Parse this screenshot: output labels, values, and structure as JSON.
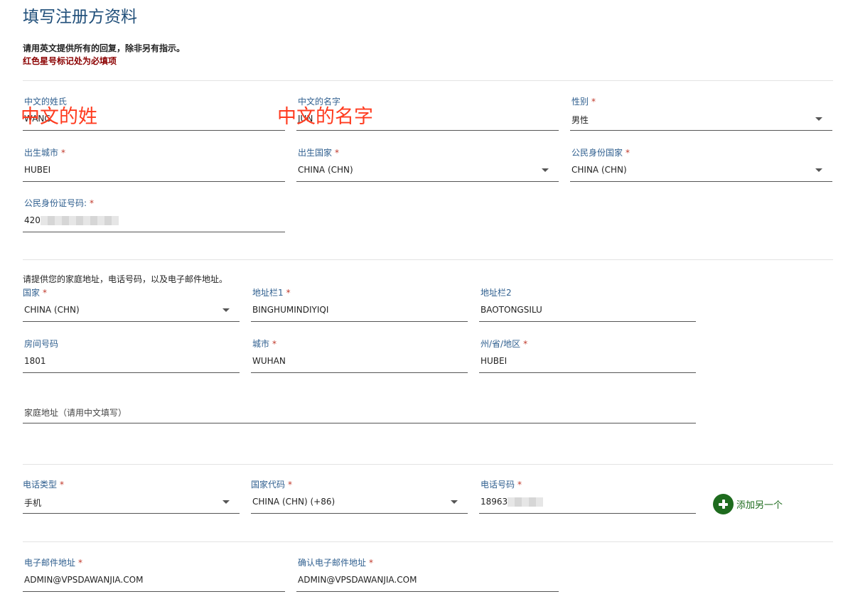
{
  "header": {
    "title": "填写注册方资料",
    "instruction": "请用英文提供所有的回复，除非另有指示。",
    "required_note": "红色星号标记处为必填项"
  },
  "personal": {
    "surname_cn": {
      "label": "中文的姓氏",
      "value": "WANG"
    },
    "given_name_cn": {
      "label": "中文的名字",
      "value": "JUN"
    },
    "gender": {
      "label": "性别",
      "value": "男性"
    },
    "birth_city": {
      "label": "出生城市",
      "value": "HUBEI"
    },
    "birth_country": {
      "label": "出生国家",
      "value": "CHINA (CHN)"
    },
    "citizenship_country": {
      "label": "公民身份国家",
      "value": "CHINA (CHN)"
    },
    "id_number": {
      "label": "公民身份证号码:",
      "value": "420"
    }
  },
  "annotations": {
    "surname_overlay": "中文的姓",
    "given_name_overlay": "中文的名字"
  },
  "address": {
    "note": "请提供您的家庭地址，电话号码，以及电子邮件地址。",
    "country": {
      "label": "国家",
      "value": "CHINA (CHN)"
    },
    "line1": {
      "label": "地址栏1",
      "value": "BINGHUMINDIYIQI"
    },
    "line2": {
      "label": "地址栏2",
      "value": "BAOTONGSILU"
    },
    "room": {
      "label": "房间号码",
      "value": "1801"
    },
    "city": {
      "label": "城市",
      "value": "WUHAN"
    },
    "state": {
      "label": "州/省/地区",
      "value": "HUBEI"
    },
    "home_address_cn": {
      "placeholder": "家庭地址（请用中文填写）"
    }
  },
  "phone": {
    "type": {
      "label": "电话类型",
      "value": "手机"
    },
    "country_code": {
      "label": "国家代码",
      "value": "CHINA (CHN) (+86)"
    },
    "number": {
      "label": "电话号码",
      "value": "18963"
    },
    "add_another": "添加另一个"
  },
  "email": {
    "email": {
      "label": "电子邮件地址",
      "value": "ADMIN@VPSDAWANJIA.COM"
    },
    "confirm": {
      "label": "确认电子邮件地址",
      "value": "ADMIN@VPSDAWANJIA.COM"
    }
  },
  "colors": {
    "accent": "#1f4e79",
    "label": "#2f5f8f",
    "required": "#c0392b",
    "add_button": "#1e6b1e",
    "overlay": "#ff3b1f"
  }
}
